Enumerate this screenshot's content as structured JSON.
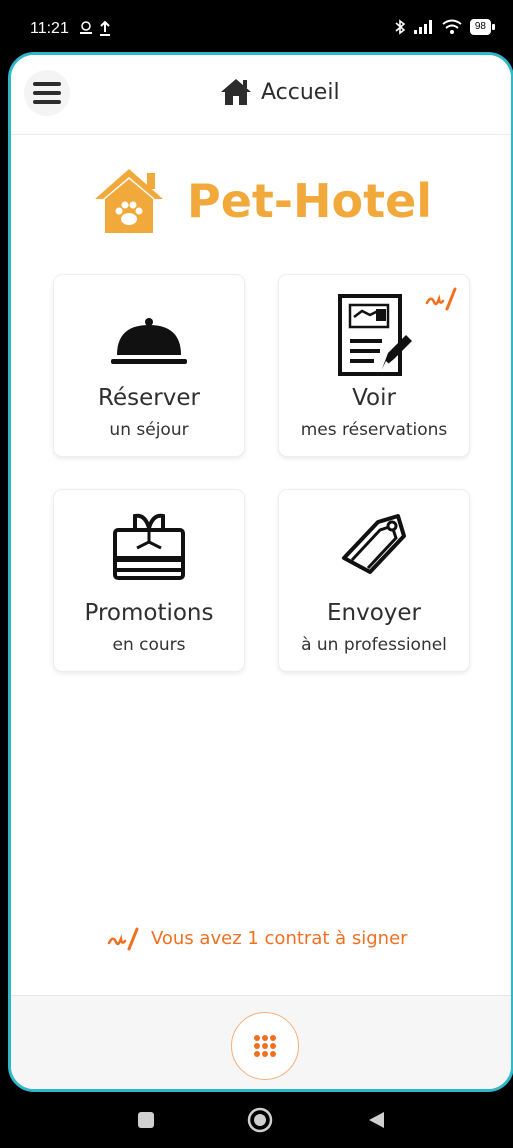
{
  "status_bar": {
    "time": "11:21",
    "battery": "98",
    "icons": [
      "drive-icon",
      "upload-icon",
      "bluetooth-icon",
      "signal-icon",
      "wifi-icon",
      "battery-icon"
    ]
  },
  "header": {
    "title": "Accueil",
    "menu_icon": "hamburger-menu-icon",
    "title_icon": "home-icon"
  },
  "brand": {
    "name": "Pet-Hotel",
    "color": "#f2a93b"
  },
  "cards": [
    {
      "title": "Réserver",
      "subtitle": "un séjour",
      "icon": "service-bell-icon"
    },
    {
      "title": "Voir",
      "subtitle": "mes réservations",
      "icon": "contract-icon",
      "badge_icon": "signature-icon"
    },
    {
      "title": "Promotions",
      "subtitle": "en cours",
      "icon": "gift-card-icon"
    },
    {
      "title": "Envoyer",
      "subtitle": "à un professionel",
      "icon": "tag-icon"
    }
  ],
  "contract_alert": {
    "text": "Vous avez 1 contrat à signer",
    "icon": "signature-icon",
    "color": "#f07020"
  },
  "bottom": {
    "apps_icon": "apps-grid-icon",
    "accent": "#f07020"
  },
  "frame_color": "#2fb8cc"
}
